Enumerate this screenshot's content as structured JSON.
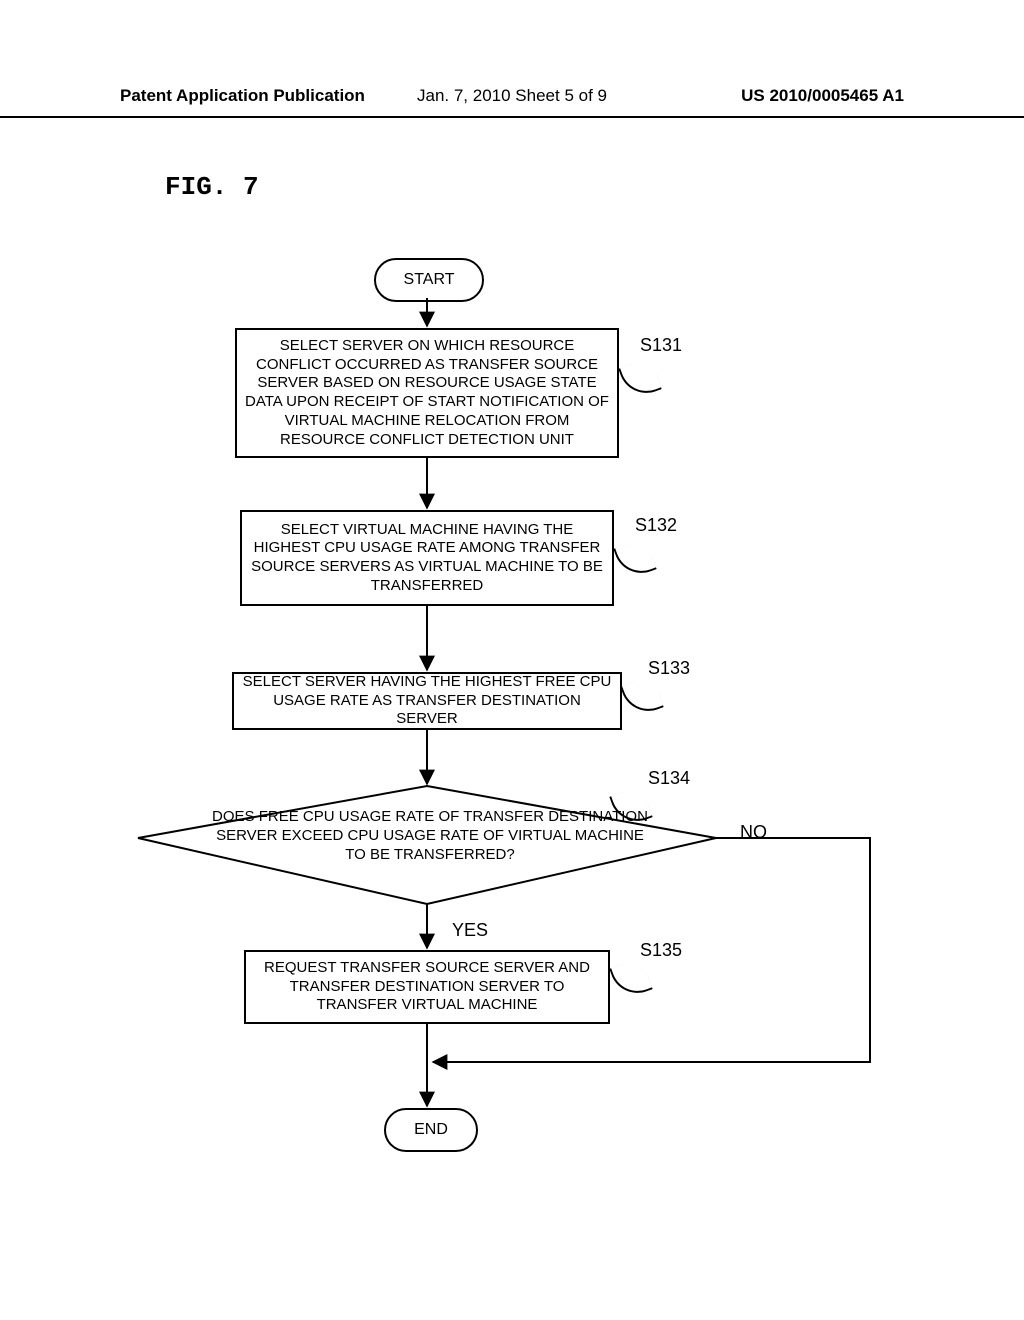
{
  "header": {
    "left": "Patent Application Publication",
    "center": "Jan. 7, 2010  Sheet 5 of 9",
    "right": "US 2010/0005465 A1"
  },
  "figure_title": "FIG. 7",
  "terminators": {
    "start": "START",
    "end": "END"
  },
  "steps": {
    "s131": {
      "ref": "S131",
      "text": "SELECT SERVER ON WHICH RESOURCE CONFLICT OCCURRED AS TRANSFER SOURCE SERVER BASED ON RESOURCE USAGE STATE DATA UPON RECEIPT OF START NOTIFICATION OF VIRTUAL MACHINE RELOCATION FROM RESOURCE CONFLICT DETECTION UNIT"
    },
    "s132": {
      "ref": "S132",
      "text": "SELECT VIRTUAL MACHINE HAVING THE HIGHEST CPU USAGE RATE AMONG TRANSFER SOURCE SERVERS AS VIRTUAL MACHINE TO BE TRANSFERRED"
    },
    "s133": {
      "ref": "S133",
      "text": "SELECT SERVER HAVING THE HIGHEST FREE CPU USAGE RATE AS TRANSFER DESTINATION SERVER"
    },
    "s134": {
      "ref": "S134",
      "text": "DOES FREE CPU USAGE RATE OF TRANSFER DESTINATION SERVER EXCEED CPU USAGE RATE OF VIRTUAL MACHINE TO BE TRANSFERRED?"
    },
    "s135": {
      "ref": "S135",
      "text": "REQUEST TRANSFER SOURCE SERVER AND TRANSFER DESTINATION SERVER TO TRANSFER VIRTUAL MACHINE"
    }
  },
  "labels": {
    "yes": "YES",
    "no": "NO"
  },
  "chart_data": {
    "type": "flowchart",
    "nodes": [
      {
        "id": "start",
        "type": "terminator",
        "text": "START"
      },
      {
        "id": "S131",
        "type": "process",
        "text": "SELECT SERVER ON WHICH RESOURCE CONFLICT OCCURRED AS TRANSFER SOURCE SERVER BASED ON RESOURCE USAGE STATE DATA UPON RECEIPT OF START NOTIFICATION OF VIRTUAL MACHINE RELOCATION FROM RESOURCE CONFLICT DETECTION UNIT"
      },
      {
        "id": "S132",
        "type": "process",
        "text": "SELECT VIRTUAL MACHINE HAVING THE HIGHEST CPU USAGE RATE AMONG TRANSFER SOURCE SERVERS AS VIRTUAL MACHINE TO BE TRANSFERRED"
      },
      {
        "id": "S133",
        "type": "process",
        "text": "SELECT SERVER HAVING THE HIGHEST FREE CPU USAGE RATE AS TRANSFER DESTINATION SERVER"
      },
      {
        "id": "S134",
        "type": "decision",
        "text": "DOES FREE CPU USAGE RATE OF TRANSFER DESTINATION SERVER EXCEED CPU USAGE RATE OF VIRTUAL MACHINE TO BE TRANSFERRED?"
      },
      {
        "id": "S135",
        "type": "process",
        "text": "REQUEST TRANSFER SOURCE SERVER AND TRANSFER DESTINATION SERVER TO TRANSFER VIRTUAL MACHINE"
      },
      {
        "id": "end",
        "type": "terminator",
        "text": "END"
      }
    ],
    "edges": [
      {
        "from": "start",
        "to": "S131"
      },
      {
        "from": "S131",
        "to": "S132"
      },
      {
        "from": "S132",
        "to": "S133"
      },
      {
        "from": "S133",
        "to": "S134"
      },
      {
        "from": "S134",
        "to": "S135",
        "label": "YES"
      },
      {
        "from": "S134",
        "to": "end",
        "label": "NO"
      },
      {
        "from": "S135",
        "to": "end"
      }
    ]
  }
}
